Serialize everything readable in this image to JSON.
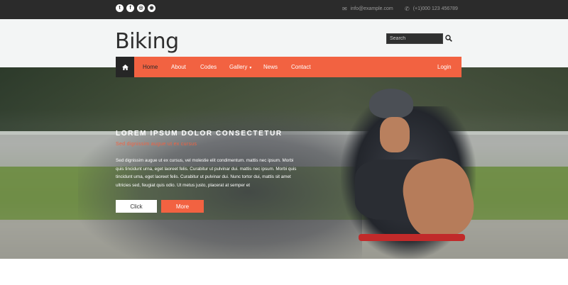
{
  "topbar": {
    "social": [
      {
        "name": "twitter-icon",
        "glyph": "t"
      },
      {
        "name": "facebook-icon",
        "glyph": "f"
      },
      {
        "name": "dribbble-icon",
        "glyph": "◎"
      },
      {
        "name": "instagram-icon",
        "glyph": "◉"
      }
    ],
    "email": "info@example.com",
    "phone": "(+1)000 123 456789"
  },
  "header": {
    "logo": "Biking",
    "search_placeholder": "Search"
  },
  "nav": {
    "items": [
      {
        "label": "Home",
        "active": true
      },
      {
        "label": "About"
      },
      {
        "label": "Codes"
      },
      {
        "label": "Gallery"
      },
      {
        "label": "News"
      },
      {
        "label": "Contact"
      },
      {
        "label": "Login"
      }
    ]
  },
  "hero": {
    "title": "LOREM IPSUM DOLOR CONSECTETUR",
    "subtitle": "Sed dignissim augue ut ex cursus",
    "text": "Sed dignissim augue ut ex cursus, vel molestie elit condimentum. mattis nec ipsum. Morbi quis tincidunt urna, eget laoreet felis. Curabitur ut pulvinar dui. mattis nec ipsum. Morbi quis tincidunt urna, eget laoreet felis. Curabitur ut pulvinar dui. Nunc tortor dui, mattis sit amet ultricies sed, feugiat quis odio. Ut metus justo, placerat at semper et",
    "btn_click": "Click",
    "btn_more": "More"
  },
  "colors": {
    "accent": "#f26241",
    "dark": "#2b2b2b"
  }
}
